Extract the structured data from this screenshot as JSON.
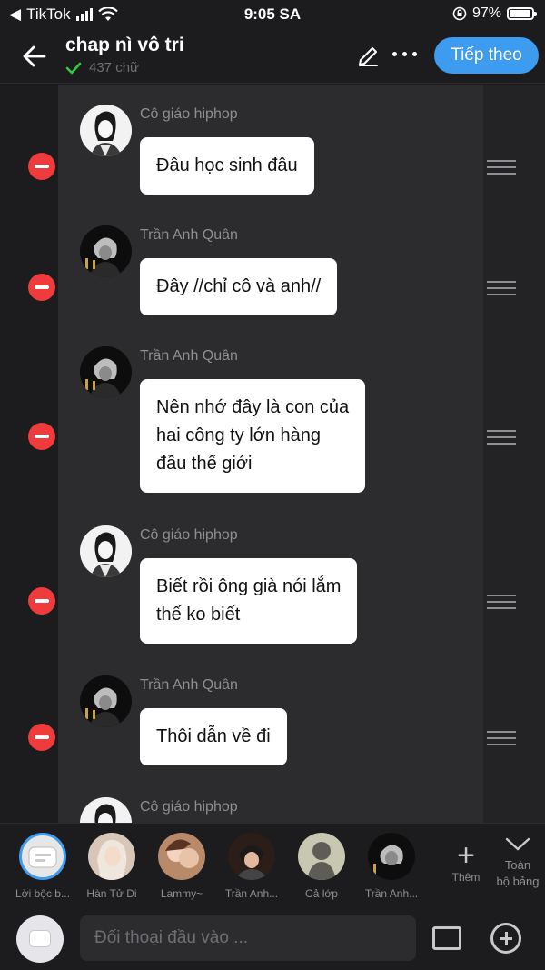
{
  "status_bar": {
    "back_app": "TikTok",
    "time": "9:05 SA",
    "battery": "97%",
    "battery_level": 0.97
  },
  "header": {
    "title": "chap nì vô tri",
    "word_count": "437 chữ",
    "next_label": "Tiếp theo",
    "icons": [
      "back-arrow-icon",
      "pen-icon",
      "more-icon"
    ]
  },
  "messages": [
    {
      "speaker": "Cô giáo hiphop",
      "text": "Đâu học sinh đâu",
      "avatar": "teacher"
    },
    {
      "speaker": "Trần Anh Quân",
      "text": "Đây //chỉ cô và anh//",
      "avatar": "quan"
    },
    {
      "speaker": "Trần Anh Quân",
      "text": "Nên nhớ đây là con của\nhai công ty lớn hàng\nđầu thế giới",
      "avatar": "quan"
    },
    {
      "speaker": "Cô giáo hiphop",
      "text": "Biết rồi ông già nói lắm\nthế ko biết",
      "avatar": "teacher"
    },
    {
      "speaker": "Trần Anh Quân",
      "text": "Thôi dẫn về đi",
      "avatar": "quan"
    },
    {
      "speaker": "Cô giáo hiphop",
      "text": "",
      "avatar": "teacher"
    }
  ],
  "characters": [
    {
      "label": "Lời bộc b...",
      "selected": true
    },
    {
      "label": "Hàn Tử Di"
    },
    {
      "label": "Lammy~"
    },
    {
      "label": "Trần Anh..."
    },
    {
      "label": "Cả lớp"
    },
    {
      "label": "Trần Anh..."
    }
  ],
  "char_actions": {
    "add": "Thêm",
    "all": "Toàn\nbộ bảng"
  },
  "input": {
    "placeholder": "Đối thoại đầu vào ..."
  }
}
